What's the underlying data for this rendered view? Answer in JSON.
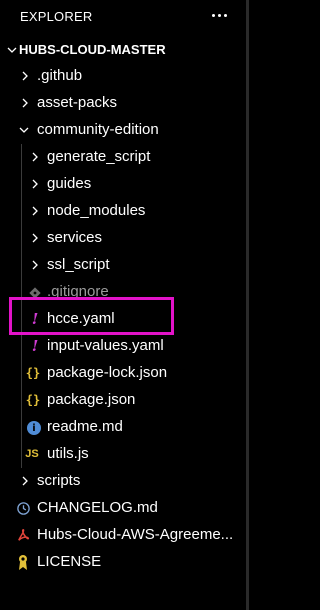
{
  "explorer": {
    "title": "EXPLORER",
    "more_actions_icon": "ellipsis-icon",
    "root": {
      "label": "HUBS-CLOUD-MASTER",
      "expanded": true
    },
    "items": [
      {
        "label": ".github",
        "kind": "folder",
        "expanded": false
      },
      {
        "label": "asset-packs",
        "kind": "folder",
        "expanded": false
      },
      {
        "label": "community-edition",
        "kind": "folder",
        "expanded": true
      },
      {
        "label": "generate_script",
        "kind": "folder",
        "expanded": false
      },
      {
        "label": "guides",
        "kind": "folder",
        "expanded": false
      },
      {
        "label": "node_modules",
        "kind": "folder",
        "expanded": false
      },
      {
        "label": "services",
        "kind": "folder",
        "expanded": false
      },
      {
        "label": "ssl_script",
        "kind": "folder",
        "expanded": false
      },
      {
        "label": ".gitignore",
        "kind": "file",
        "icon": "git-diamond-icon",
        "icon_glyph": ""
      },
      {
        "label": "hcce.yaml",
        "kind": "file",
        "icon": "yaml-icon",
        "icon_glyph": "!"
      },
      {
        "label": "input-values.yaml",
        "kind": "file",
        "icon": "yaml-icon",
        "icon_glyph": "!"
      },
      {
        "label": "package-lock.json",
        "kind": "file",
        "icon": "json-icon",
        "icon_glyph": "{}"
      },
      {
        "label": "package.json",
        "kind": "file",
        "icon": "json-icon",
        "icon_glyph": "{}"
      },
      {
        "label": "readme.md",
        "kind": "file",
        "icon": "info-icon",
        "icon_glyph": "i"
      },
      {
        "label": "utils.js",
        "kind": "file",
        "icon": "javascript-icon",
        "icon_glyph": "JS"
      },
      {
        "label": "scripts",
        "kind": "folder",
        "expanded": false
      },
      {
        "label": "CHANGELOG.md",
        "kind": "file",
        "icon": "history-icon"
      },
      {
        "label": "Hubs-Cloud-AWS-Agreeme...",
        "kind": "file",
        "icon": "pdf-icon"
      },
      {
        "label": "LICENSE",
        "kind": "file",
        "icon": "license-icon"
      }
    ]
  },
  "colors": {
    "background": "#000000",
    "text": "#ffffff",
    "dimmed_text": "#9b9b9b",
    "yaml_accent": "#d03bd3",
    "json_accent": "#e2c039",
    "info_accent": "#4f8cd6",
    "pdf_accent": "#e0443a",
    "license_accent": "#e2c039",
    "indent_guide": "#3b3b3b",
    "highlight_box": "#e313c9"
  }
}
